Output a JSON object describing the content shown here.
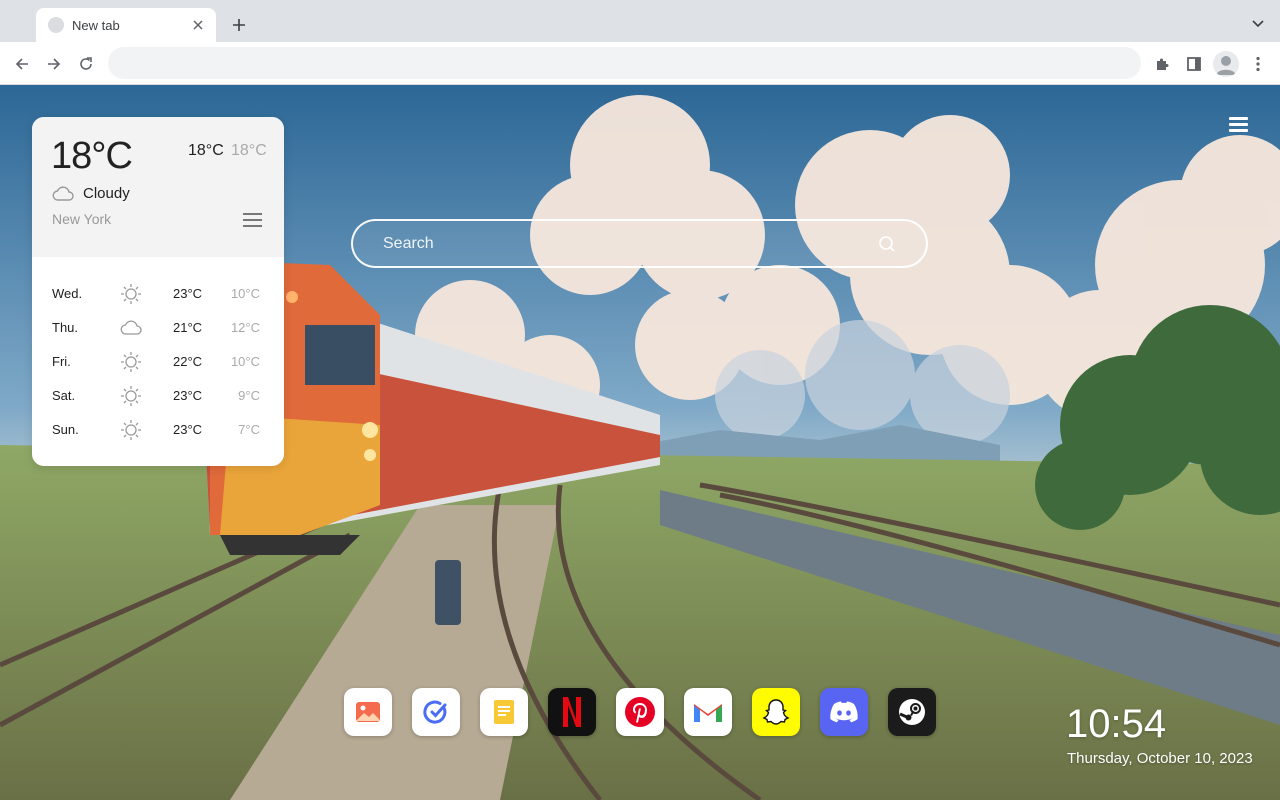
{
  "browser": {
    "tab_title": "New tab",
    "address_value": "",
    "address_placeholder": ""
  },
  "weather": {
    "current_temp": "18°C",
    "high": "18°C",
    "low": "18°C",
    "condition": "Cloudy",
    "condition_icon": "cloud-icon",
    "city": "New York",
    "forecast": [
      {
        "day": "Wed.",
        "icon": "sun-icon",
        "high": "23°C",
        "low": "10°C"
      },
      {
        "day": "Thu.",
        "icon": "cloud-icon",
        "high": "21°C",
        "low": "12°C"
      },
      {
        "day": "Fri.",
        "icon": "sun-icon",
        "high": "22°C",
        "low": "10°C"
      },
      {
        "day": "Sat.",
        "icon": "sun-icon",
        "high": "23°C",
        "low": "9°C"
      },
      {
        "day": "Sun.",
        "icon": "sun-icon",
        "high": "23°C",
        "low": "7°C"
      }
    ]
  },
  "search": {
    "placeholder": "Search"
  },
  "dock": [
    {
      "name": "gallery-app",
      "icon": "image-icon"
    },
    {
      "name": "tasks-app",
      "icon": "checkmark-circle-icon"
    },
    {
      "name": "notes-app",
      "icon": "note-icon"
    },
    {
      "name": "netflix-app",
      "icon": "netflix-icon"
    },
    {
      "name": "pinterest-app",
      "icon": "pinterest-icon"
    },
    {
      "name": "gmail-app",
      "icon": "gmail-icon"
    },
    {
      "name": "snapchat-app",
      "icon": "snapchat-icon"
    },
    {
      "name": "discord-app",
      "icon": "discord-icon"
    },
    {
      "name": "steam-app",
      "icon": "steam-icon"
    }
  ],
  "clock": {
    "time": "10:54",
    "date": "Thursday, October 10, 2023"
  }
}
